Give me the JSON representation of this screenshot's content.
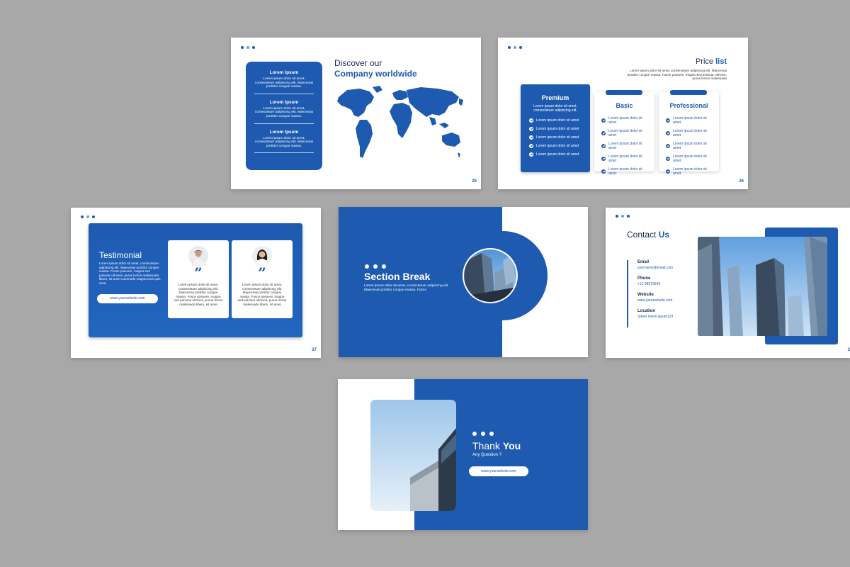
{
  "colors": {
    "background": "#a8a8a8",
    "brand_blue": "#1e5bb0",
    "slide": "#ffffff"
  },
  "slide25": {
    "title_line1": "Discover our",
    "title_line2": "Company worldwide",
    "items": [
      {
        "heading": "Lorem Ipsum",
        "text": "Lorem ipsum dolor sit amet, consectetuer adipiscing elit. Maecenas porttitor congue massa."
      },
      {
        "heading": "Lorem Ipsum",
        "text": "Lorem ipsum dolor sit amet, consectetuer adipiscing elit. Maecenas porttitor congue massa."
      },
      {
        "heading": "Lorem Ipsum",
        "text": "Lorem ipsum dolor sit amet, consectetuer adipiscing elit. Maecenas porttitor congue massa."
      }
    ],
    "page": "25"
  },
  "slide26": {
    "title_plain": "Price",
    "title_bold": "list",
    "intro": "Lorem ipsum dolor sit amet, consectetuer adipiscing elit. Maecenas porttitor congue massa. Fusce posuere, magna sed pulvinar ultricies, purus lectus malesuada",
    "plans": [
      {
        "name": "Premium",
        "desc": "Lorem ipsum dolor sit amet, consectetuer adipiscing elit.",
        "features": [
          "Lorem ipsum dolor sit amet",
          "Lorem ipsum dolor sit amet",
          "Lorem ipsum dolor sit amet",
          "Lorem ipsum dolor sit amet",
          "Lorem ipsum dolor sit amet"
        ]
      },
      {
        "name": "Basic",
        "features": [
          "Lorem ipsum dolor sit amet",
          "Lorem ipsum dolor sit amet",
          "Lorem ipsum dolor sit amet",
          "Lorem ipsum dolor sit amet",
          "Lorem ipsum dolor sit amet"
        ]
      },
      {
        "name": "Professional",
        "features": [
          "Lorem ipsum dolor sit amet",
          "Lorem ipsum dolor sit amet",
          "Lorem ipsum dolor sit amet",
          "Lorem ipsum dolor sit amet",
          "Lorem ipsum dolor sit amet"
        ]
      }
    ],
    "page": "26"
  },
  "slide27": {
    "title": "Testimonial",
    "text": "Lorem ipsum dolor sit amet, consectetuer adipiscing elit. Maecenas porttitor congue massa. Fusce posuere, magna sed pulvinar ultricies, purus lectus malesuada libero, sit amet commodo magna eros quis urna.",
    "website": "www.yourwebsite.com",
    "quote_mark": "”",
    "cards": [
      {
        "text": "Lorem ipsum dolor sit amet, consectetuer adipiscing elit. Maecenas porttitor congue massa. Fusce posuere, magna sed pulvinar ultricies, purus lectus malesuada libero, sit amet"
      },
      {
        "text": "Lorem ipsum dolor sit amet, consectetuer adipiscing elit. Maecenas porttitor congue massa. Fusce posuere, magna sed pulvinar ultricies, purus lectus malesuada libero, sit amet"
      }
    ],
    "page": "27"
  },
  "section": {
    "title": "Section Break",
    "text": "Lorem ipsum dolor sit amet, consectetuer adipiscing elit. Maecenas porttitor congue massa. Fusce"
  },
  "contact": {
    "title_plain": "Contact",
    "title_bold": "Us",
    "fields": [
      {
        "label": "Email",
        "value": "yourname@email.com"
      },
      {
        "label": "Phone",
        "value": "+12 98979543"
      },
      {
        "label": "Website",
        "value": "www.yourwebsite.com"
      },
      {
        "label": "Location",
        "value": "Street lorem ipsum123"
      }
    ],
    "page": "2"
  },
  "thanks": {
    "title_plain": "Thank",
    "title_bold": "You",
    "subtitle": "Any Question ?",
    "website": "www.yourwebsite.com"
  }
}
